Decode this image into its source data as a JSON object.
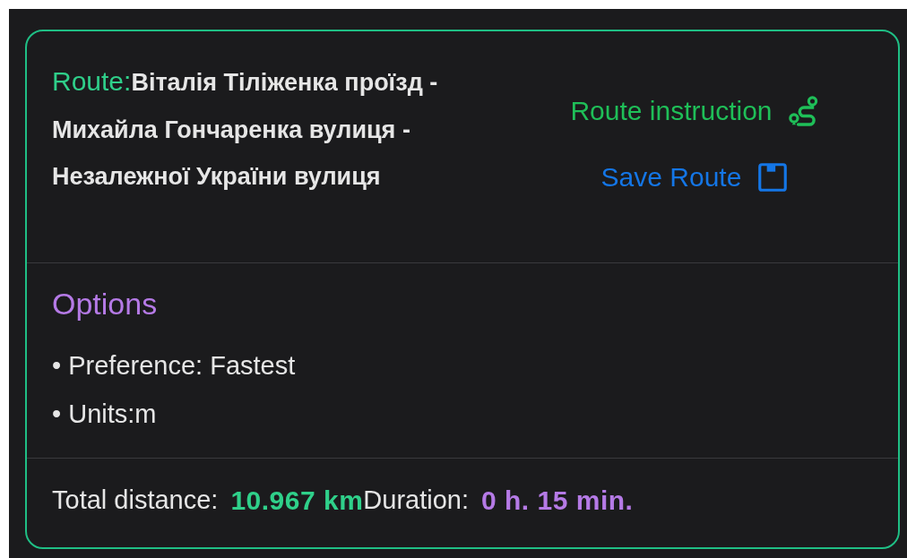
{
  "route": {
    "label": "Route:",
    "name": "Віталія Тіліженка проїзд - Михайла Гончаренка вулиця - Незалежної України вулиця"
  },
  "actions": [
    {
      "kind": "instruction",
      "label": "Route instruction"
    },
    {
      "kind": "save",
      "label": "Save Route"
    }
  ],
  "options": {
    "title": "Options",
    "items": [
      "• Preference: Fastest",
      "• Units:m"
    ]
  },
  "summary": {
    "distance_label": "Total distance:",
    "distance": "10.967 km",
    "duration_label": "Duration:",
    "duration": "0 h. 15 min."
  }
}
